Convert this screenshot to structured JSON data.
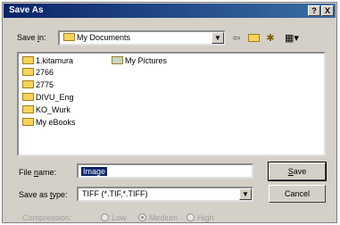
{
  "window": {
    "title": "Save As",
    "help_label": "?",
    "close_label": "X"
  },
  "save_in": {
    "label_pre": "Save ",
    "label_key": "i",
    "label_post": "n:",
    "value": "My Documents"
  },
  "toolbar": {
    "back_icon": "back-arrow-icon",
    "up_icon": "up-folder-icon",
    "new_folder_icon": "new-folder-icon",
    "views_icon": "views-menu-icon"
  },
  "files": [
    {
      "name": "1.kitamura",
      "type": "folder"
    },
    {
      "name": "2766",
      "type": "folder"
    },
    {
      "name": "2775",
      "type": "folder"
    },
    {
      "name": "DIVU_Eng",
      "type": "folder"
    },
    {
      "name": "KO_Wurk",
      "type": "folder"
    },
    {
      "name": "My eBooks",
      "type": "folder"
    },
    {
      "name": "My Pictures",
      "type": "special-folder"
    }
  ],
  "file_name": {
    "label_pre": "File ",
    "label_key": "n",
    "label_post": "ame:",
    "value": "Image"
  },
  "save_as_type": {
    "label_pre": "Save as ",
    "label_key": "t",
    "label_post": "ype:",
    "value": "TIFF (*.TIF,*.TIFF)"
  },
  "buttons": {
    "save_key": "S",
    "save_rest": "ave",
    "cancel": "Cancel"
  },
  "compression": {
    "label": "Compression:",
    "options": [
      "Low",
      "Medium",
      "High"
    ],
    "selected": "Medium"
  }
}
